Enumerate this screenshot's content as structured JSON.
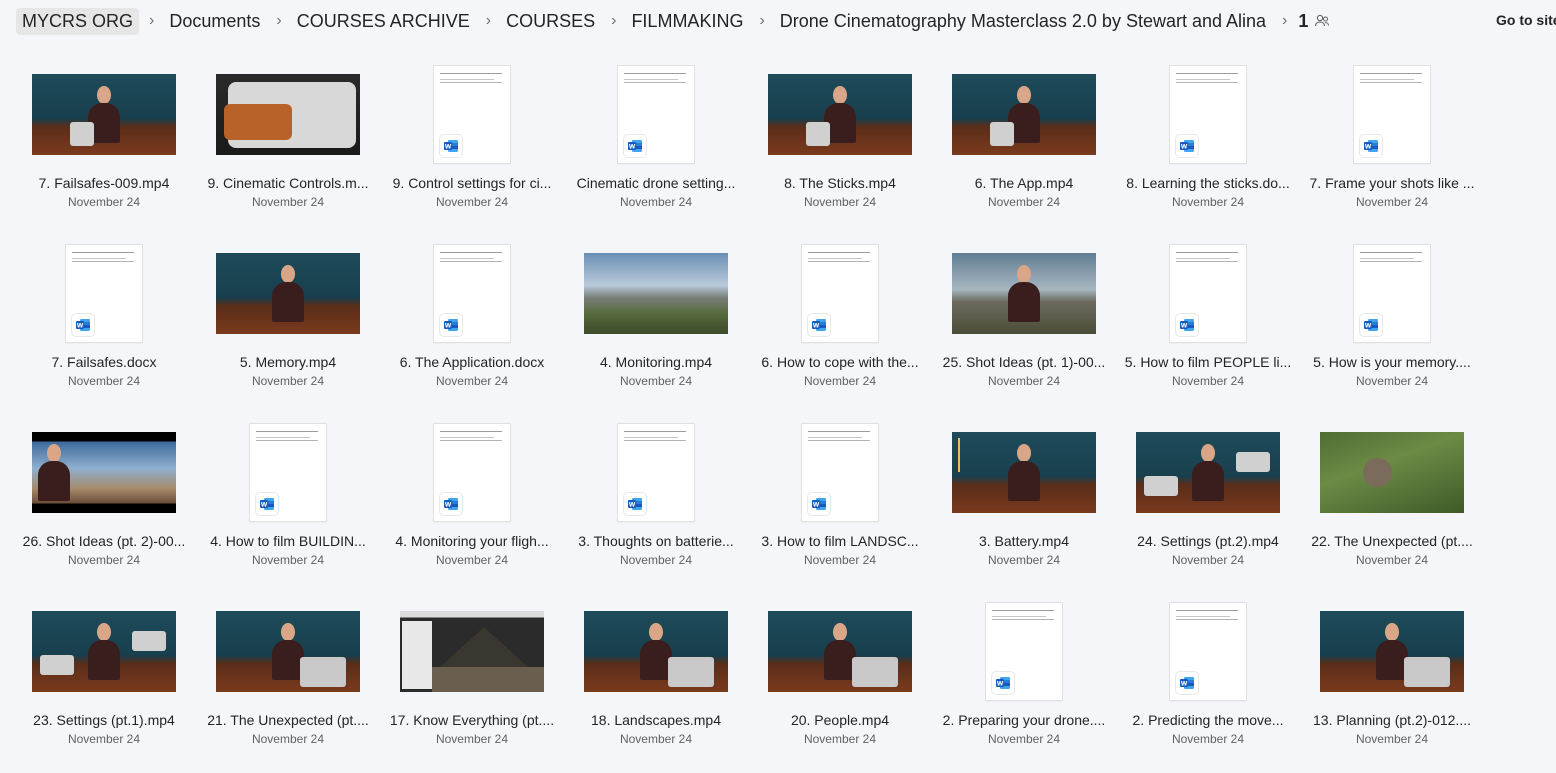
{
  "breadcrumb": {
    "items": [
      "MYCRS ORG",
      "Documents",
      "COURSES ARCHIVE",
      "COURSES",
      "FILMMAKING",
      "Drone Cinematography Masterclass 2.0 by Stewart and Alina"
    ],
    "separator": "›",
    "count": "1",
    "people_icon": "people-icon"
  },
  "go_to_site": "Go to site",
  "files": [
    {
      "name": "7. Failsafes-009.mp4",
      "date": "November 24",
      "kind": "video",
      "thumb": "presenter-drone"
    },
    {
      "name": "9. Cinematic Controls.m...",
      "date": "November 24",
      "kind": "video",
      "thumb": "phone-controller"
    },
    {
      "name": "9. Control settings for ci...",
      "date": "November 24",
      "kind": "docx"
    },
    {
      "name": "Cinematic drone setting...",
      "date": "November 24",
      "kind": "docx"
    },
    {
      "name": "8. The Sticks.mp4",
      "date": "November 24",
      "kind": "video",
      "thumb": "presenter-drone"
    },
    {
      "name": "6. The App.mp4",
      "date": "November 24",
      "kind": "video",
      "thumb": "presenter-drone"
    },
    {
      "name": "8. Learning the sticks.do...",
      "date": "November 24",
      "kind": "docx"
    },
    {
      "name": "7. Frame your shots like ...",
      "date": "November 24",
      "kind": "docx"
    },
    {
      "name": "7. Failsafes.docx",
      "date": "November 24",
      "kind": "docx"
    },
    {
      "name": "5. Memory.mp4",
      "date": "November 24",
      "kind": "video",
      "thumb": "presenter"
    },
    {
      "name": "6. The Application.docx",
      "date": "November 24",
      "kind": "docx"
    },
    {
      "name": "4. Monitoring.mp4",
      "date": "November 24",
      "kind": "video",
      "thumb": "landscape"
    },
    {
      "name": "6. How to cope with the...",
      "date": "November 24",
      "kind": "docx"
    },
    {
      "name": "25. Shot Ideas (pt. 1)-00...",
      "date": "November 24",
      "kind": "video",
      "thumb": "mountain-presenter"
    },
    {
      "name": "5. How to film PEOPLE li...",
      "date": "November 24",
      "kind": "docx"
    },
    {
      "name": "5. How is your memory....",
      "date": "November 24",
      "kind": "docx"
    },
    {
      "name": "26. Shot Ideas (pt. 2)-00...",
      "date": "November 24",
      "kind": "video",
      "thumb": "castle"
    },
    {
      "name": "4. How to film BUILDIN...",
      "date": "November 24",
      "kind": "docx"
    },
    {
      "name": "4. Monitoring your fligh...",
      "date": "November 24",
      "kind": "docx"
    },
    {
      "name": "3. Thoughts on batterie...",
      "date": "November 24",
      "kind": "docx"
    },
    {
      "name": "3. How to film LANDSC...",
      "date": "November 24",
      "kind": "docx"
    },
    {
      "name": "3. Battery.mp4",
      "date": "November 24",
      "kind": "video",
      "thumb": "presenter-stats"
    },
    {
      "name": "24. Settings (pt.2).mp4",
      "date": "November 24",
      "kind": "video",
      "thumb": "presenter-drones"
    },
    {
      "name": "22. The Unexpected (pt....",
      "date": "November 24",
      "kind": "video",
      "thumb": "aerial"
    },
    {
      "name": "23. Settings (pt.1).mp4",
      "date": "November 24",
      "kind": "video",
      "thumb": "presenter-drones"
    },
    {
      "name": "21. The Unexpected (pt....",
      "date": "November 24",
      "kind": "video",
      "thumb": "presenter-laptop"
    },
    {
      "name": "17. Know Everything (pt....",
      "date": "November 24",
      "kind": "video",
      "thumb": "software"
    },
    {
      "name": "18. Landscapes.mp4",
      "date": "November 24",
      "kind": "video",
      "thumb": "presenter-laptop"
    },
    {
      "name": "20. People.mp4",
      "date": "November 24",
      "kind": "video",
      "thumb": "presenter-laptop"
    },
    {
      "name": "2. Preparing your drone....",
      "date": "November 24",
      "kind": "docx"
    },
    {
      "name": "2. Predicting the move...",
      "date": "November 24",
      "kind": "docx"
    },
    {
      "name": "13. Planning (pt.2)-012....",
      "date": "November 24",
      "kind": "video",
      "thumb": "presenter-laptop"
    }
  ],
  "colors": {
    "word_blue": "#185abd",
    "background": "#f5f6f9"
  }
}
